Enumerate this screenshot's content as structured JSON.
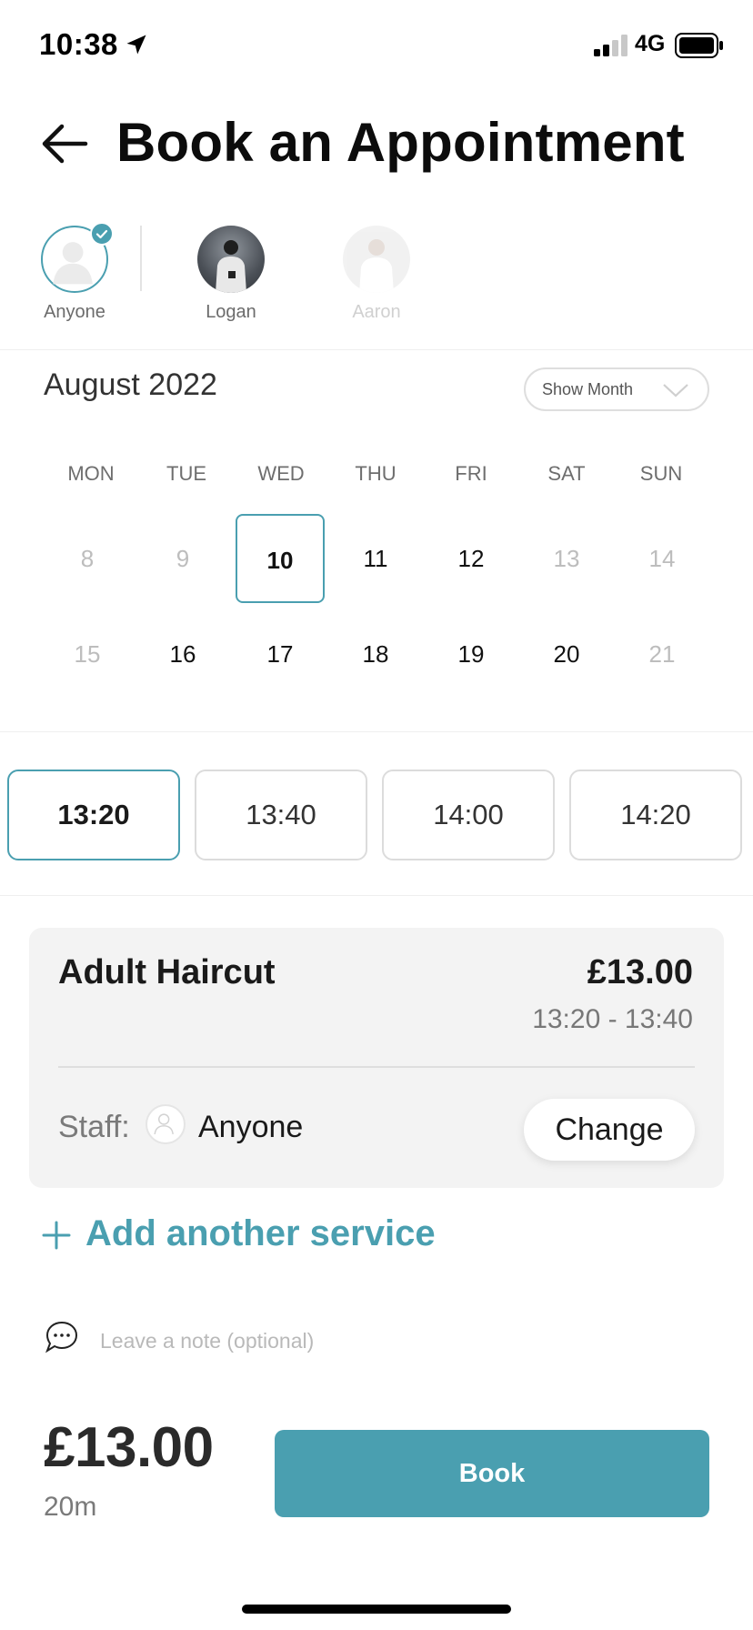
{
  "status_bar": {
    "time": "10:38",
    "network": "4G"
  },
  "header": {
    "title": "Book an Appointment"
  },
  "staff": [
    {
      "name": "Anyone",
      "selected": true
    },
    {
      "name": "Logan",
      "selected": false
    },
    {
      "name": "Aaron",
      "selected": false,
      "available": false
    }
  ],
  "calendar": {
    "month": "August 2022",
    "show_month_label": "Show Month",
    "weekdays": [
      "MON",
      "TUE",
      "WED",
      "THU",
      "FRI",
      "SAT",
      "SUN"
    ],
    "week1": [
      "8",
      "9",
      "10",
      "11",
      "12",
      "13",
      "14"
    ],
    "week2": [
      "15",
      "16",
      "17",
      "18",
      "19",
      "20",
      "21"
    ],
    "selected_day": "10",
    "unavailable_days": [
      "8",
      "9",
      "13",
      "14",
      "15",
      "21"
    ]
  },
  "time_slots": [
    "13:20",
    "13:40",
    "14:00",
    "14:20"
  ],
  "selected_slot": "13:20",
  "service": {
    "name": "Adult Haircut",
    "price": "£13.00",
    "time_range": "13:20 - 13:40",
    "staff_label": "Staff:",
    "staff_value": "Anyone",
    "change_label": "Change"
  },
  "add_service_label": "Add another service",
  "note": {
    "placeholder": "Leave a note (optional)"
  },
  "footer": {
    "total": "£13.00",
    "duration": "20m",
    "book_label": "Book"
  },
  "colors": {
    "accent": "#4a9fb0"
  }
}
